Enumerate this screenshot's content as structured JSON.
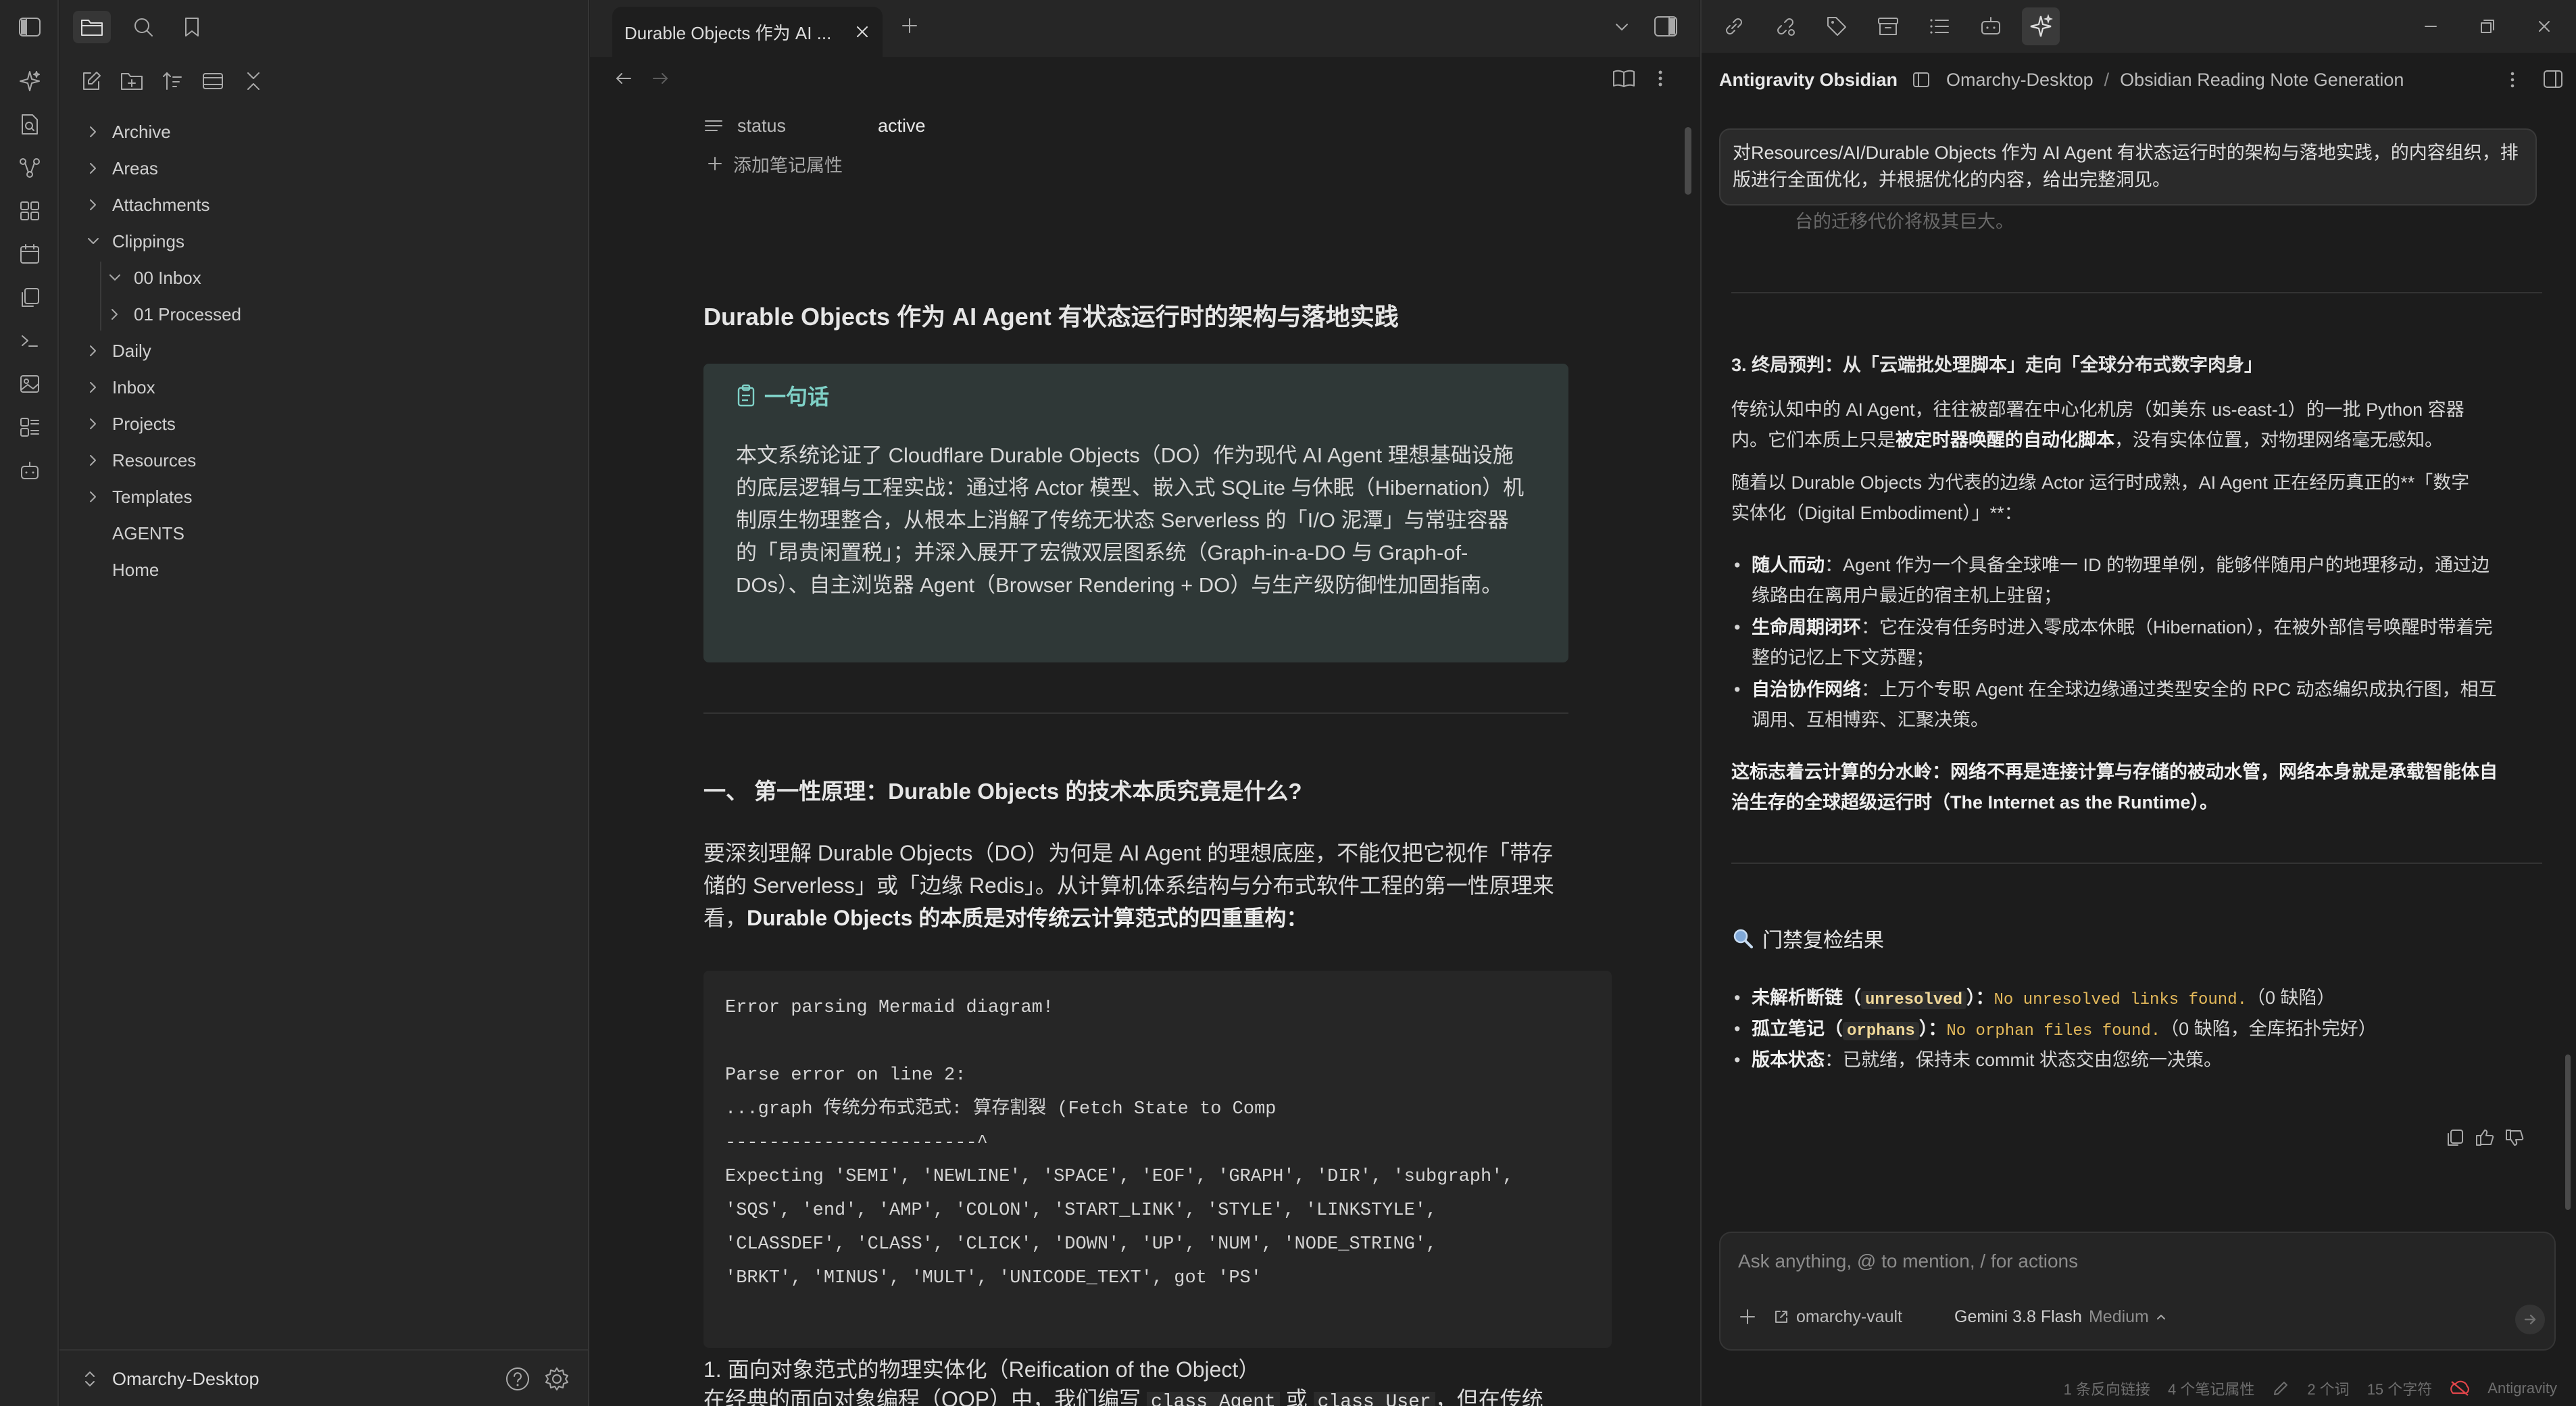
{
  "colors": {
    "accent": "#7fd1c7",
    "background": "#1e1e1e",
    "sidebar": "#262626",
    "callout_bg": "#2f3837",
    "inline_code": "#e4b95a",
    "error_red": "#e0454a"
  },
  "sidebar": {
    "vault_name": "Omarchy-Desktop",
    "tree": [
      {
        "label": "Archive",
        "type": "folder",
        "expanded": false
      },
      {
        "label": "Areas",
        "type": "folder",
        "expanded": false
      },
      {
        "label": "Attachments",
        "type": "folder",
        "expanded": false
      },
      {
        "label": "Clippings",
        "type": "folder",
        "expanded": true
      },
      {
        "label": "00 Inbox",
        "type": "folder",
        "expanded": true
      },
      {
        "label": "01 Processed",
        "type": "folder",
        "expanded": false
      },
      {
        "label": "Daily",
        "type": "folder",
        "expanded": false
      },
      {
        "label": "Inbox",
        "type": "folder",
        "expanded": false
      },
      {
        "label": "Projects",
        "type": "folder",
        "expanded": false
      },
      {
        "label": "Resources",
        "type": "folder",
        "expanded": false
      },
      {
        "label": "Templates",
        "type": "folder",
        "expanded": false
      },
      {
        "label": "AGENTS",
        "type": "file"
      },
      {
        "label": "Home",
        "type": "file"
      }
    ]
  },
  "tab": {
    "title": "Durable Objects 作为 AI ..."
  },
  "editor": {
    "property_name": "status",
    "property_value": "active",
    "add_property": "添加笔记属性",
    "title": "Durable Objects 作为 AI Agent 有状态运行时的架构与落地实践",
    "callout_title": "一句话",
    "callout_lines": [
      "本文系统论证了 Cloudflare Durable Objects（DO）作为现代 AI Agent 理想基础设施",
      "的底层逻辑与工程实战：通过将 Actor 模型、嵌入式 SQLite 与休眠（Hibernation）机",
      "制原生物理整合，从根本上消解了传统无状态 Serverless 的「I/O 泥潭」与常驻容器",
      "的「昂贵闲置税」；并深入展开了宏微双层图系统（Graph-in-a-DO 与 Graph-of-",
      "DOs）、自主浏览器 Agent（Browser Rendering + DO）与生产级防御性加固指南。"
    ],
    "section_heading": "一、 第一性原理：Durable Objects 的技术本质究竟是什么?",
    "para_line1": "要深刻理解 Durable Objects（DO）为何是 AI Agent 的理想底座，不能仅把它视作「带存",
    "para_line2": "储的 Serverless」或「边缘 Redis」。从计算机体系结构与分布式软件工程的第一性原理来",
    "para_line3_plain": "看，",
    "para_line3_bold": "Durable Objects 的本质是对传统云计算范式的四重重构：",
    "code_lines": [
      "Error parsing Mermaid diagram!",
      "",
      "Parse error on line 2:",
      "...graph 传统分布式范式: 算存割裂 (Fetch State to Comp",
      "-----------------------^",
      "Expecting 'SEMI', 'NEWLINE', 'SPACE', 'EOF', 'GRAPH', 'DIR', 'subgraph',",
      "'SQS', 'end', 'AMP', 'COLON', 'START_LINK', 'STYLE', 'LINKSTYLE',",
      "'CLASSDEF', 'CLASS', 'CLICK', 'DOWN', 'UP', 'NUM', 'NODE_STRING',",
      "'BRKT', 'MINUS', 'MULT', 'UNICODE_TEXT', got 'PS'"
    ],
    "sub_heading": "1. 面向对象范式的物理实体化（Reification of the Object）",
    "cut_line_a": "在经典的面向对象编程（OOP）中，我们编写 ",
    "cut_code1": "class Agent",
    "cut_mid": " 或 ",
    "cut_code2": "class User",
    "cut_end": "，但在传统"
  },
  "agent": {
    "title": "Antigravity Obsidian",
    "breadcrumb_vault": "Omarchy-Desktop",
    "breadcrumb_sep": "/",
    "breadcrumb_chat": "Obsidian Reading Note Generation",
    "prompt": "对Resources/AI/Durable Objects 作为 AI Agent 有状态运行时的架构与落地实践，的内容组织，排版进行全面优化，并根据优化的内容，给出完整洞见。",
    "faded_line": "台的迁移代价将极其巨大。",
    "prediction_heading": "3. 终局预判：从「云端批处理脚本」走向「全球分布式数字肉身」",
    "p1_a": "传统认知中的 AI Agent，往往被部署在中心化机房（如美东 us-east-1）的一批 Python 容器",
    "p1_b_plain": "内。它们本质上只是",
    "p1_b_bold": "被定时器唤醒的自动化脚本",
    "p1_b_end": "，没有实体位置，对物理网络毫无感知。",
    "p2_a": "随着以 Durable Objects 为代表的边缘 Actor 运行时成熟，AI Agent 正在经历真正的**「数字",
    "p2_b": "实体化（Digital Embodiment）」**：",
    "bullets": [
      {
        "bold": "随人而动",
        "l1": "：Agent 作为一个具备全球唯一 ID 的物理单例，能够伴随用户的地理移动，通过边",
        "l2": "缘路由在离用户最近的宿主机上驻留；"
      },
      {
        "bold": "生命周期闭环",
        "l1": "：它在没有任务时进入零成本休眠（Hibernation），在被外部信号唤醒时带着完",
        "l2": "整的记忆上下文苏醒；"
      },
      {
        "bold": "自治协作网络",
        "l1": "：上万个专职 Agent 在全球边缘通过类型安全的 RPC 动态编织成执行图，相互",
        "l2": "调用、互相博弈、汇聚决策。"
      }
    ],
    "conclusion_1": "这标志着云计算的分水岭：网络不再是连接计算与存储的被动水管，网络本身就是承载智能体自",
    "conclusion_2": "治生存的全球超级运行时（The Internet as the Runtime）。",
    "check_heading": "门禁复检结果",
    "checks": [
      {
        "label": "未解析断链（",
        "code": "unresolved",
        "mid": "）：",
        "mono": "No unresolved links found.",
        "after": "（0 缺陷）"
      },
      {
        "label": "孤立笔记（",
        "code": "orphans",
        "mid": "）：",
        "mono": "No orphan files found.",
        "after": "（0 缺陷，全库拓扑完好）"
      }
    ],
    "version_label": "版本状态",
    "version_text": "：已就绪，保持未 commit 状态交由您统一决策。",
    "input_placeholder": "Ask anything, @ to mention, / for actions",
    "context_vault": "omarchy-vault",
    "model": "Gemini 3.8 Flash",
    "model_mode": "Medium"
  },
  "statusbar": {
    "backlinks": "1 条反向链接",
    "properties": "4 个笔记属性",
    "words": "2 个词",
    "chars": "15 个字符",
    "plugin": "Antigravity"
  }
}
